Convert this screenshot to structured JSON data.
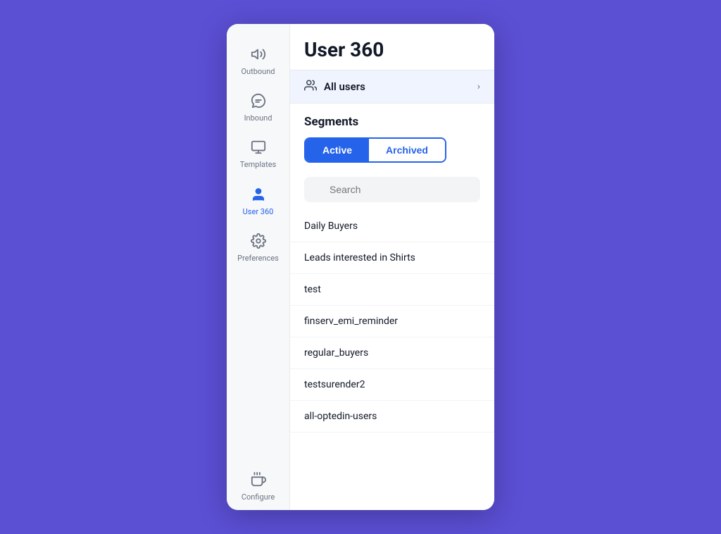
{
  "page": {
    "title": "User 360",
    "background_color": "#5b4fd4"
  },
  "sidebar": {
    "items": [
      {
        "id": "outbound",
        "label": "Outbound",
        "icon": "📣",
        "active": false
      },
      {
        "id": "inbound",
        "label": "Inbound",
        "icon": "🪝",
        "active": false
      },
      {
        "id": "templates",
        "label": "Templates",
        "icon": "🖥",
        "active": false
      },
      {
        "id": "user360",
        "label": "User 360",
        "icon": "👤",
        "active": true
      },
      {
        "id": "preferences",
        "label": "Preferences",
        "icon": "⚙️",
        "active": false
      },
      {
        "id": "configure",
        "label": "Configure",
        "icon": "🔔",
        "active": false
      }
    ]
  },
  "all_users": {
    "label": "All users",
    "chevron": "›"
  },
  "segments": {
    "title": "Segments",
    "tabs": [
      {
        "id": "active",
        "label": "Active",
        "active": true
      },
      {
        "id": "archived",
        "label": "Archived",
        "active": false
      }
    ],
    "search_placeholder": "Search",
    "items": [
      "Daily Buyers",
      "Leads interested in Shirts",
      "test",
      "finserv_emi_reminder",
      "regular_buyers",
      "testsurender2",
      "all-optedin-users"
    ]
  }
}
